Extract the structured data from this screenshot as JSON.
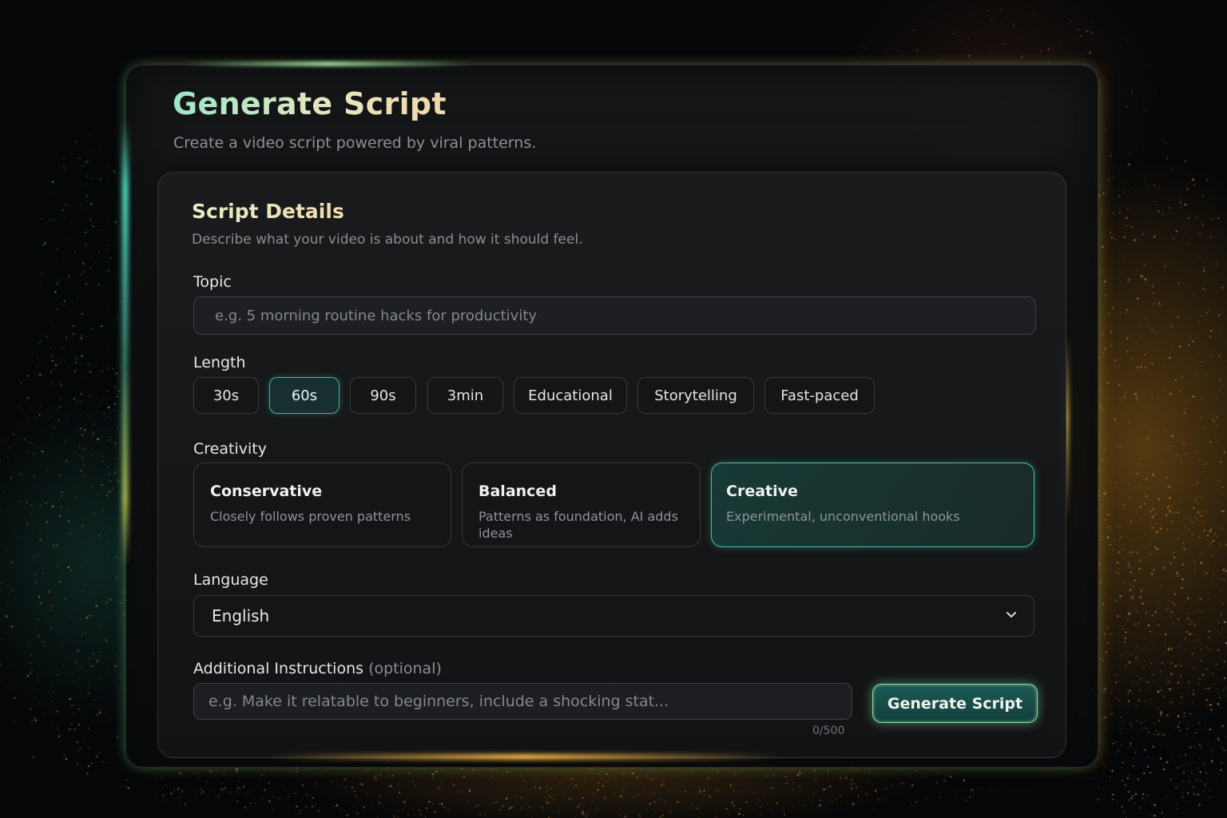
{
  "page": {
    "title": "Generate Script",
    "subtitle": "Create a video script powered by viral patterns."
  },
  "section": {
    "title": "Script Details",
    "subtitle": "Describe what your video is about and how it should feel."
  },
  "topic": {
    "label": "Topic",
    "placeholder": "e.g. 5 morning routine hacks for productivity",
    "value": ""
  },
  "length": {
    "label": "Length",
    "options": [
      {
        "label": "30s",
        "selected": false
      },
      {
        "label": "60s",
        "selected": true
      },
      {
        "label": "90s",
        "selected": false
      },
      {
        "label": "3min",
        "selected": false
      },
      {
        "label": "Educational",
        "selected": false
      },
      {
        "label": "Storytelling",
        "selected": false
      },
      {
        "label": "Fast-paced",
        "selected": false
      }
    ]
  },
  "creativity": {
    "label": "Creativity",
    "options": [
      {
        "title": "Conservative",
        "description": "Closely follows proven patterns",
        "selected": false
      },
      {
        "title": "Balanced",
        "description": "Patterns as foundation, AI adds ideas",
        "selected": false
      },
      {
        "title": "Creative",
        "description": "Experimental, unconventional hooks",
        "selected": true
      }
    ]
  },
  "language": {
    "label": "Language",
    "value": "English",
    "icon": "chevron-down-icon"
  },
  "instructions": {
    "label": "Additional Instructions",
    "optional_label": "(optional)",
    "placeholder": "e.g. Make it relatable to beginners, include a shocking stat...",
    "value": "",
    "counter": "0/500"
  },
  "actions": {
    "generate_label": "Generate Script"
  },
  "colors": {
    "accent_teal": "#3fb6a0",
    "glow_gold": "#f0b040",
    "background": "#050608"
  }
}
